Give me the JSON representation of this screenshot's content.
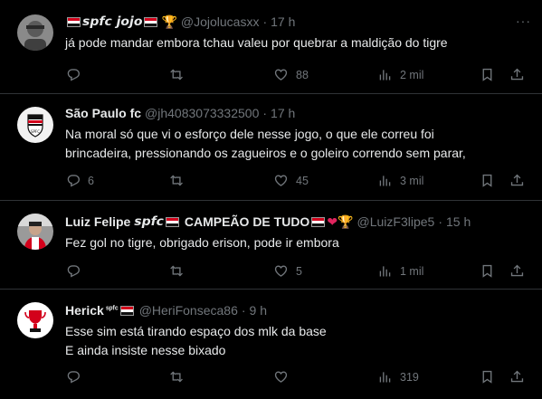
{
  "tweets": [
    {
      "name_parts": [
        "𝙨𝙥𝙛𝙘 𝙟𝙤𝙟𝙤"
      ],
      "handle": "@Jojolucasxx",
      "time": "17 h",
      "text": "já pode mandar embora tchau valeu por quebrar a maldição do tigre",
      "replies": "",
      "retweets": "",
      "likes": "88",
      "views": "2 mil"
    },
    {
      "name_parts": [
        "São Paulo fc"
      ],
      "handle": "@jh4083073332500",
      "time": "17 h",
      "text": "Na moral só que vi o esforço dele nesse jogo, o que ele correu foi\nbrincadeira, pressionando os zagueiros e o goleiro correndo sem parar,",
      "replies": "6",
      "retweets": "",
      "likes": "45",
      "views": "3 mil"
    },
    {
      "name_parts": [
        "Luiz Felipe",
        "𝙨𝙥𝙛𝙘",
        "CAMPEÃO DE TUDO"
      ],
      "handle": "@LuizF3lipe5",
      "time": "15 h",
      "text": "Fez gol no tigre, obrigado erison, pode ir embora",
      "replies": "",
      "retweets": "",
      "likes": "5",
      "views": "1 mil"
    },
    {
      "name_parts": [
        "Herick",
        "ˢᵖᶠᶜ"
      ],
      "handle": "@HeriFonseca86",
      "time": "9 h",
      "text": "Esse sim está tirando espaço dos mlk da base\nE ainda insiste nesse bixado",
      "replies": "",
      "retweets": "",
      "likes": "",
      "views": "319"
    }
  ],
  "icons": {
    "more": "more-options-icon",
    "reply": "reply-icon",
    "retweet": "retweet-icon",
    "like": "like-icon",
    "views": "views-icon",
    "bookmark": "bookmark-icon",
    "share": "share-icon"
  },
  "colors": {
    "background": "#000000",
    "text": "#e7e9ea",
    "muted": "#71767b",
    "divider": "#2f3336"
  }
}
